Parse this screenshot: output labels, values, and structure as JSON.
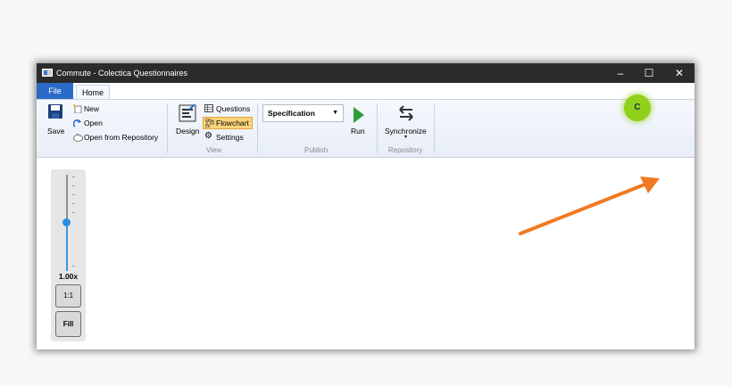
{
  "window": {
    "title": "Commute - Colectica Questionnaires",
    "controls": {
      "minimize": "–",
      "maximize": "☐",
      "close": "✕"
    }
  },
  "tabs": {
    "file": "File",
    "home": "Home"
  },
  "ribbon": {
    "save": "Save",
    "new": "New",
    "open": "Open",
    "open_from_repository": "Open from Repository",
    "design": "Design",
    "questions": "Questions",
    "flowchart": "Flowchart",
    "settings": "Settings",
    "view_group": "View",
    "specification": "Specification",
    "run": "Run",
    "publish_group": "Publish",
    "synchronize": "Synchronize",
    "repository_group": "Repository"
  },
  "zoom": {
    "level": "1.00x",
    "reset_label": "1:1",
    "fill_label": "Fill",
    "slider_fraction": 0.5
  },
  "refresh_button": {
    "glyph": "C"
  },
  "colors": {
    "accent": "#2a6ac7",
    "highlight": "#fbd47a",
    "refresh": "#8fd11a",
    "annotation_arrow": "#f07a22"
  }
}
